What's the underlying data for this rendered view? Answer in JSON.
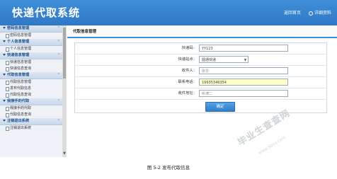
{
  "app": {
    "title": "快递代取系统"
  },
  "top_links": {
    "home": "返回首页",
    "info": "详细资料"
  },
  "sidebar": {
    "groups": [
      {
        "label": "密码信息管理",
        "items": [
          "密码信息管理"
        ]
      },
      {
        "label": "个人信息管理",
        "items": [
          "个人信息管理"
        ]
      },
      {
        "label": "快递信息管理",
        "items": [
          "快递信息管理",
          "快递信息查询"
        ]
      },
      {
        "label": "代取信息管理",
        "items": [
          "代取信息管理",
          "发布代取信息",
          "代取信息查询"
        ]
      },
      {
        "label": "我接手的代取",
        "items": [
          "我接手的代取",
          "代取信息查询"
        ]
      },
      {
        "label": "注销退出系统",
        "items": [
          "注销退出系统"
        ]
      }
    ]
  },
  "main": {
    "tab": "代取信息管理",
    "form": {
      "tracking_label": "快递码：",
      "tracking_value": "YY123",
      "station_label": "快递站点：",
      "station_value": "圆通快递",
      "recipient_label": "收件人：",
      "recipient_value": "张华",
      "phone_label": "联系电话：",
      "phone_value": "19935346354",
      "address_label": "收件地址：",
      "address_value": "听涛二",
      "submit": "确定"
    }
  },
  "caption": "图 5-2 发布代取信息",
  "watermark": {
    "text": "毕业生查查网",
    "url": "www.sbvv.com"
  }
}
